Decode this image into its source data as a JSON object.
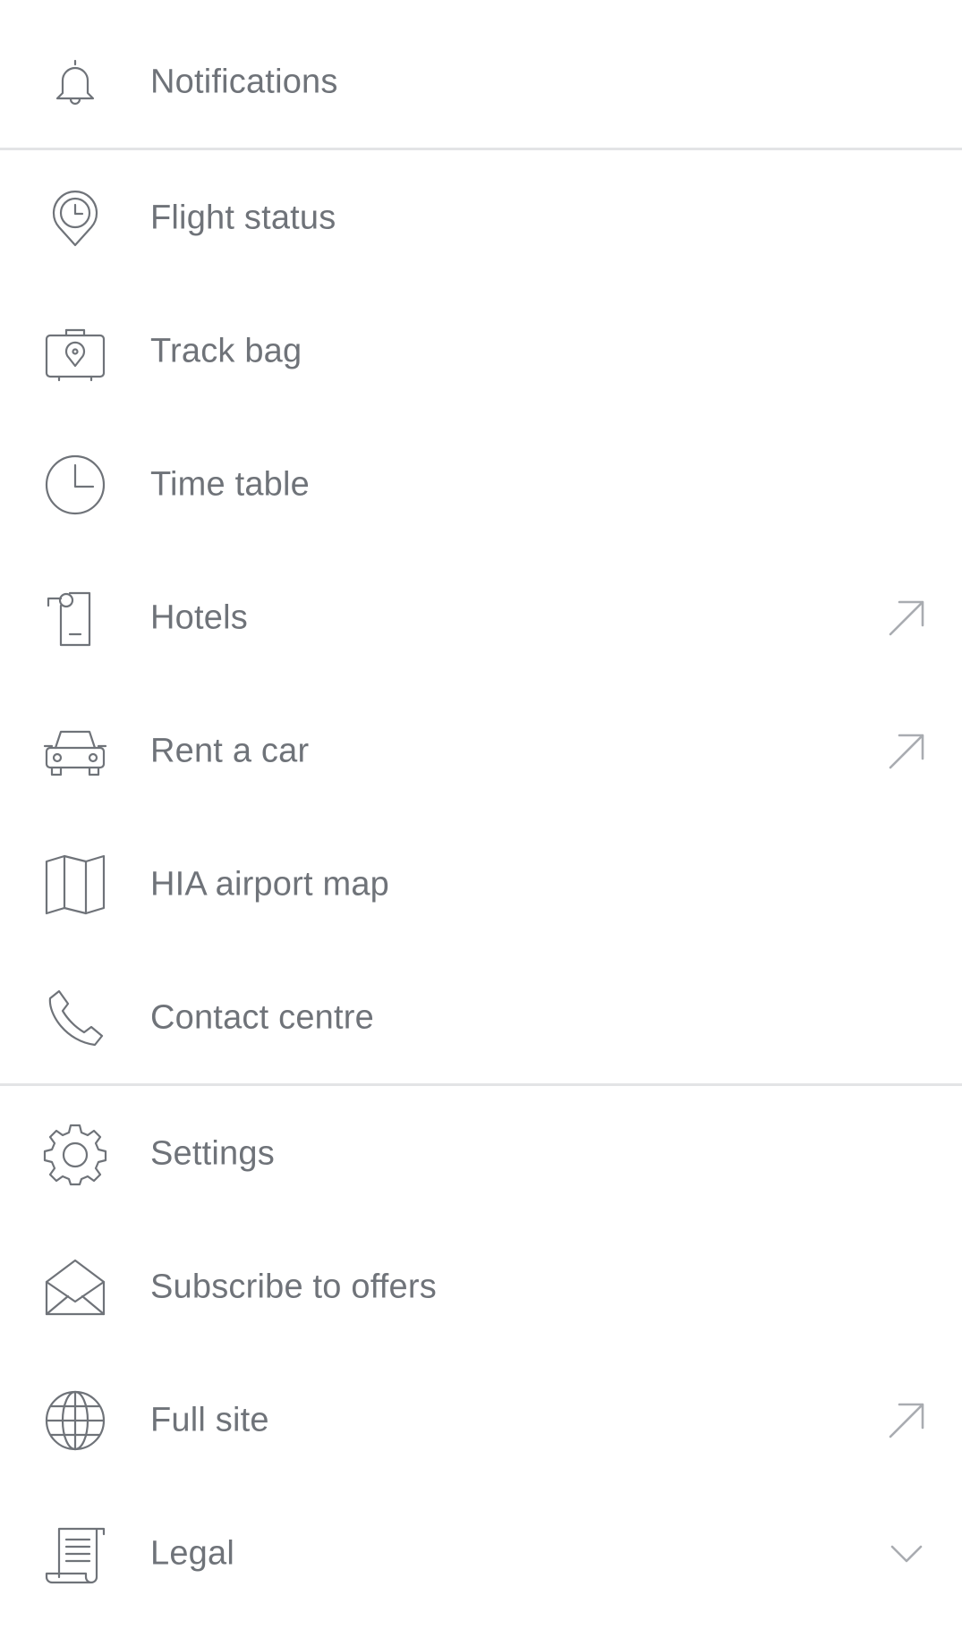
{
  "menu": {
    "items": [
      {
        "label": "Notifications",
        "icon": "bell-icon"
      },
      {
        "label": "Flight status",
        "icon": "location-clock-icon"
      },
      {
        "label": "Track bag",
        "icon": "luggage-location-icon"
      },
      {
        "label": "Time table",
        "icon": "clock-icon"
      },
      {
        "label": "Hotels",
        "icon": "door-hanger-icon",
        "trailing": "external-arrow-icon"
      },
      {
        "label": "Rent a car",
        "icon": "car-icon",
        "trailing": "external-arrow-icon"
      },
      {
        "label": "HIA airport map",
        "icon": "map-icon"
      },
      {
        "label": "Contact centre",
        "icon": "phone-icon"
      },
      {
        "label": "Settings",
        "icon": "gear-icon"
      },
      {
        "label": "Subscribe to offers",
        "icon": "open-envelope-icon"
      },
      {
        "label": "Full site",
        "icon": "globe-icon",
        "trailing": "external-arrow-icon"
      },
      {
        "label": "Legal",
        "icon": "scroll-document-icon",
        "trailing": "chevron-down-icon"
      }
    ]
  },
  "colors": {
    "text": "#6f7379",
    "trailing_icon": "#a9acb1",
    "divider": "#e3e4e6",
    "background": "#ffffff"
  }
}
